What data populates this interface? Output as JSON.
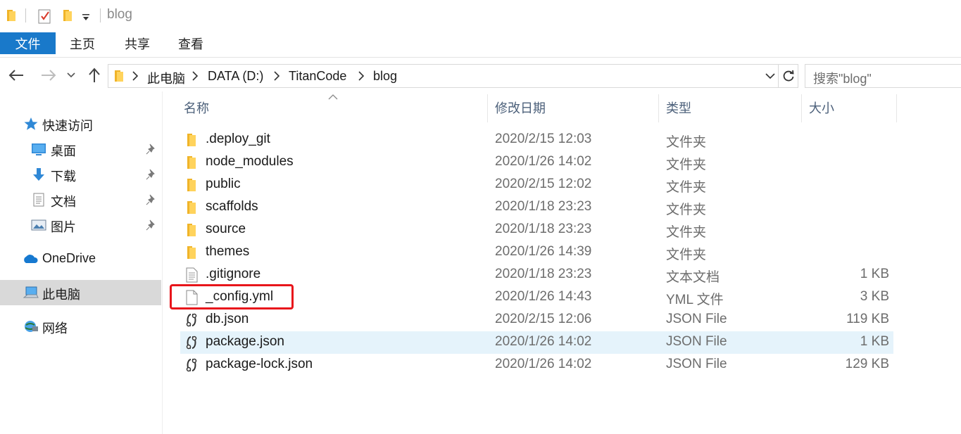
{
  "window": {
    "title": "blog",
    "quick_access_icons": [
      "folder-icon",
      "properties-icon",
      "new-folder-icon",
      "customize-dropdown-icon"
    ]
  },
  "ribbon": {
    "tabs": [
      "文件",
      "主页",
      "共享",
      "查看"
    ],
    "active_tab": "文件",
    "accent_color": "#1979ca"
  },
  "nav": {
    "breadcrumbs": [
      "此电脑",
      "DATA (D:)",
      "TitanCode",
      "blog"
    ],
    "search_placeholder": "搜索\"blog\""
  },
  "sidebar": {
    "items": [
      {
        "label": "快速访问",
        "icon": "star-icon",
        "pinned": false
      },
      {
        "label": "桌面",
        "icon": "desktop-icon",
        "pinned": true
      },
      {
        "label": "下载",
        "icon": "download-arrow-icon",
        "pinned": true
      },
      {
        "label": "文档",
        "icon": "document-icon",
        "pinned": true
      },
      {
        "label": "图片",
        "icon": "pictures-icon",
        "pinned": true
      },
      {
        "label": "OneDrive",
        "icon": "cloud-icon",
        "pinned": false
      },
      {
        "label": "此电脑",
        "icon": "computer-icon",
        "pinned": false,
        "selected": true
      },
      {
        "label": "网络",
        "icon": "network-icon",
        "pinned": false
      }
    ]
  },
  "columns": {
    "name": "名称",
    "date": "修改日期",
    "type": "类型",
    "size": "大小",
    "sorted_by": "名称"
  },
  "files": [
    {
      "name": ".deploy_git",
      "date": "2020/2/15 12:03",
      "type": "文件夹",
      "size": "",
      "icon": "folder-icon"
    },
    {
      "name": "node_modules",
      "date": "2020/1/26 14:02",
      "type": "文件夹",
      "size": "",
      "icon": "folder-icon"
    },
    {
      "name": "public",
      "date": "2020/2/15 12:02",
      "type": "文件夹",
      "size": "",
      "icon": "folder-icon"
    },
    {
      "name": "scaffolds",
      "date": "2020/1/18 23:23",
      "type": "文件夹",
      "size": "",
      "icon": "folder-icon"
    },
    {
      "name": "source",
      "date": "2020/1/18 23:23",
      "type": "文件夹",
      "size": "",
      "icon": "folder-icon"
    },
    {
      "name": "themes",
      "date": "2020/1/26 14:39",
      "type": "文件夹",
      "size": "",
      "icon": "folder-icon"
    },
    {
      "name": ".gitignore",
      "date": "2020/1/18 23:23",
      "type": "文本文档",
      "size": "1 KB",
      "icon": "text-file-icon"
    },
    {
      "name": "_config.yml",
      "date": "2020/1/26 14:43",
      "type": "YML 文件",
      "size": "3 KB",
      "icon": "blank-file-icon",
      "highlighted": true
    },
    {
      "name": "db.json",
      "date": "2020/2/15 12:06",
      "type": "JSON File",
      "size": "119 KB",
      "icon": "json-file-icon"
    },
    {
      "name": "package.json",
      "date": "2020/1/26 14:02",
      "type": "JSON File",
      "size": "1 KB",
      "icon": "json-file-icon",
      "hovered": true
    },
    {
      "name": "package-lock.json",
      "date": "2020/1/26 14:02",
      "type": "JSON File",
      "size": "129 KB",
      "icon": "json-file-icon"
    }
  ],
  "annotation": {
    "highlight_color": "#e8151b"
  }
}
